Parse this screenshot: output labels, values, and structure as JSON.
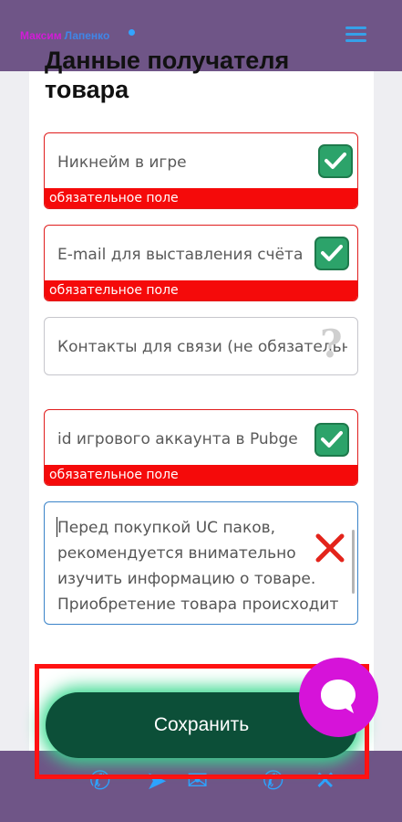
{
  "header": {
    "logo_first": "Максим",
    "logo_last": "Лапенко",
    "menu_icon": "hamburger-menu-icon"
  },
  "form": {
    "title": "Данные получателя товара",
    "fields": [
      {
        "placeholder": "Никнейм в игре",
        "status": "valid",
        "error": "обязательное поле"
      },
      {
        "placeholder": "E-mail для выставления счёта",
        "status": "valid",
        "error": "обязательное поле"
      },
      {
        "placeholder": "Контакты для связи (не обязательно)",
        "status": "unknown"
      },
      {
        "placeholder": "id игрового аккаунта в Pubge",
        "status": "valid",
        "error": "обязательное поле"
      }
    ],
    "textarea": {
      "text": "Перед покупкой UC паков, рекомендуется внимательно изучить информацию о товаре. Приобретение товара происходит",
      "status": "invalid"
    },
    "save_label": "Сохранить"
  },
  "colors": {
    "header_bg": "#6f5587",
    "error_red": "#f50a0a",
    "save_bg": "#0c4f38",
    "chat_bg": "#d613d9",
    "check_green": "#2ca36a"
  },
  "social_icons": [
    "phone-icon",
    "telegram-icon",
    "email-icon",
    "viber-icon",
    "vk-icon"
  ]
}
